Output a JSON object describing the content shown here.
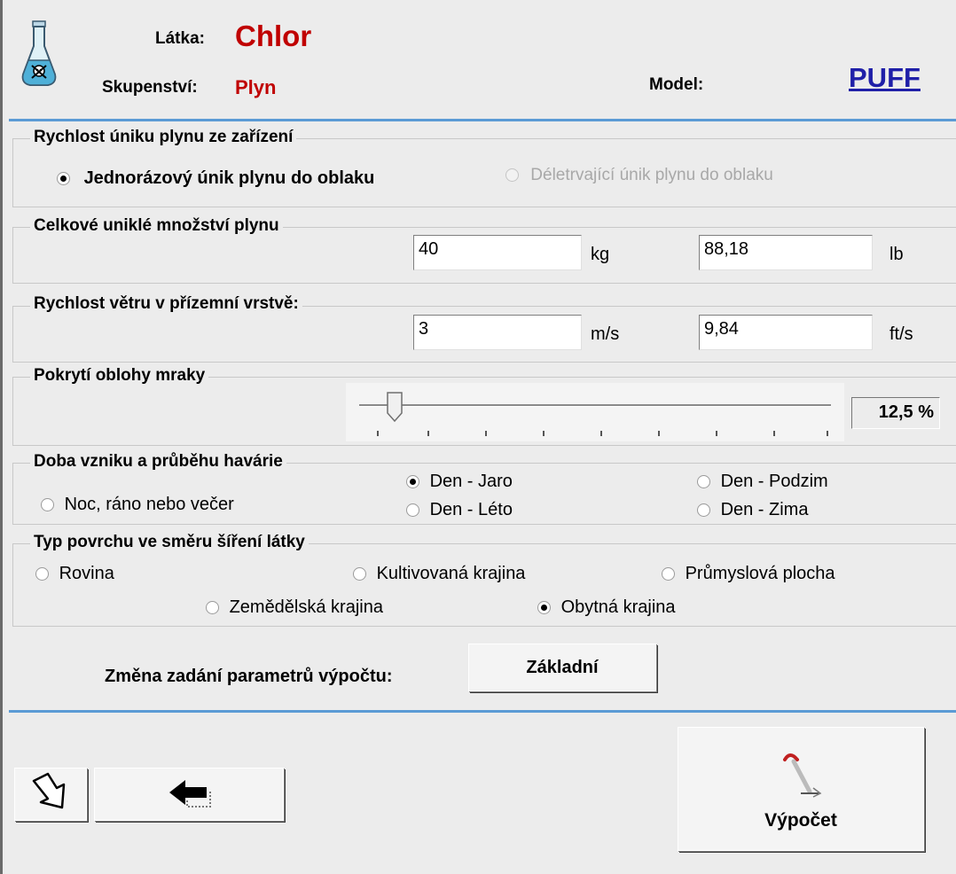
{
  "header": {
    "substance_label": "Látka:",
    "substance_value": "Chlor",
    "state_label": "Skupenství:",
    "state_value": "Plyn",
    "model_label": "Model:",
    "model_value": "PUFF"
  },
  "release_rate": {
    "title": "Rychlost úniku plynu ze zařízení",
    "option_instant": "Jednorázový únik plynu do oblaku",
    "option_continuous": "Déletrvající únik plynu do oblaku",
    "selected": "instant"
  },
  "amount": {
    "title": "Celkové uniklé množství plynu",
    "value_kg": "40",
    "unit_kg": "kg",
    "value_lb": "88,18",
    "unit_lb": "lb"
  },
  "wind": {
    "title": "Rychlost větru v přízemní vrstvě:",
    "value_ms": "3",
    "unit_ms": "m/s",
    "value_fts": "9,84",
    "unit_fts": "ft/s"
  },
  "cloud_cover": {
    "title": "Pokrytí oblohy mraky",
    "value_fraction": 0.125,
    "display": "12,5 %"
  },
  "time_of_accident": {
    "title": "Doba vzniku a průběhu havárie",
    "opt_night": "Noc, ráno nebo večer",
    "opt_spring": "Den - Jaro",
    "opt_summer": "Den - Léto",
    "opt_autumn": "Den - Podzim",
    "opt_winter": "Den - Zima",
    "selected": "spring"
  },
  "surface": {
    "title": "Typ povrchu ve směru šíření látky",
    "opt_plain": "Rovina",
    "opt_cultivated": "Kultivovaná krajina",
    "opt_industrial": "Průmyslová plocha",
    "opt_agricultural": "Zemědělská krajina",
    "opt_residential": "Obytná krajina",
    "selected": "residential"
  },
  "params": {
    "label": "Změna zadání parametrů výpočtu:",
    "button": "Základní"
  },
  "actions": {
    "compute": "Výpočet"
  },
  "colors": {
    "substance": "#c00000",
    "model": "#1f1fa8",
    "divider": "#5b9bd5"
  },
  "icons": {
    "substance": "flask-icon",
    "nav_forward": "arrow-down-right-icon",
    "nav_back": "arrow-left-icon",
    "compute": "calculation-icon"
  }
}
